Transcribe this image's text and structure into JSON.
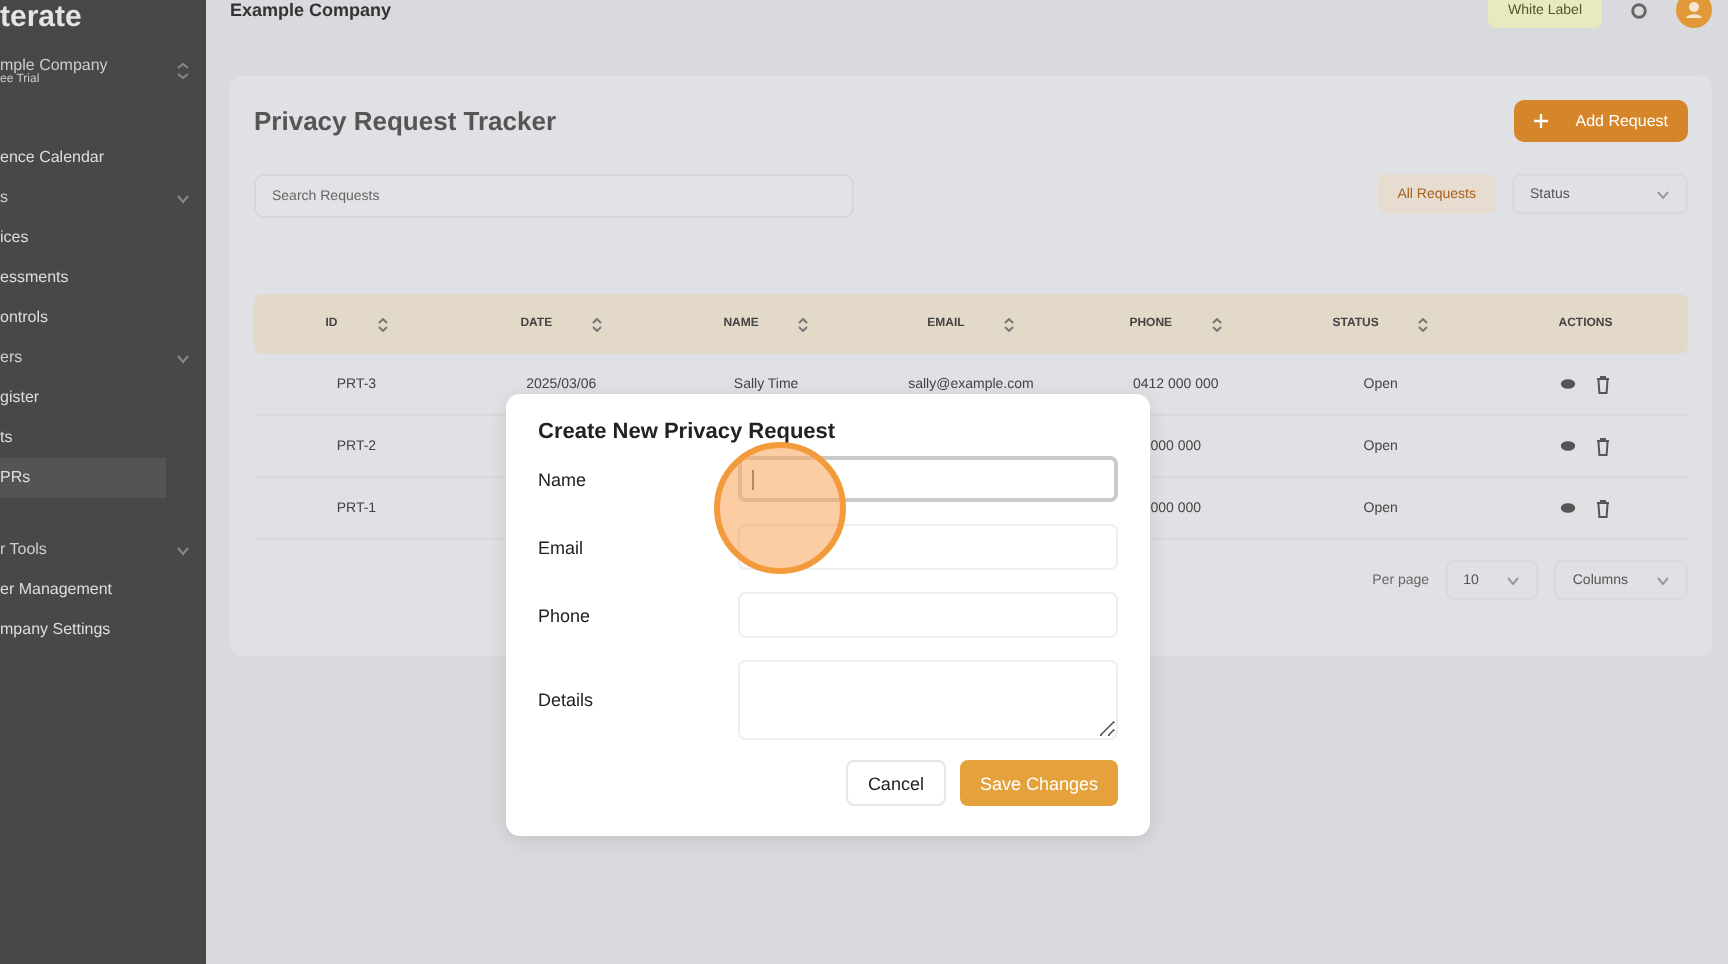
{
  "sidebar": {
    "logo": "terate",
    "company": "mple Company",
    "plan": "ee Trial",
    "items": [
      {
        "kind": "link",
        "label": "ence Calendar",
        "selected": false
      },
      {
        "kind": "group",
        "label": "s",
        "selected": false
      },
      {
        "kind": "link",
        "label": "ices",
        "selected": false
      },
      {
        "kind": "link",
        "label": "essments",
        "selected": false
      },
      {
        "kind": "link",
        "label": "ontrols",
        "selected": false
      },
      {
        "kind": "group",
        "label": "ers",
        "selected": false
      },
      {
        "kind": "link",
        "label": "gister",
        "selected": false
      },
      {
        "kind": "link",
        "label": "ts",
        "selected": false
      },
      {
        "kind": "link",
        "label": "PRs",
        "selected": true
      },
      {
        "kind": "group",
        "label": "r Tools",
        "selected": false
      },
      {
        "kind": "link",
        "label": "er Management",
        "selected": false
      },
      {
        "kind": "link",
        "label": "mpany Settings",
        "selected": false
      }
    ]
  },
  "header": {
    "company": "Example Company",
    "badge": "White Label"
  },
  "page": {
    "title": "Privacy Request Tracker",
    "add_button": "Add Request",
    "search": {
      "placeholder": "Search Requests"
    },
    "filter": "All Requests",
    "status_select": "Status"
  },
  "table": {
    "columns": [
      "ID",
      "DATE",
      "NAME",
      "EMAIL",
      "PHONE",
      "STATUS",
      "ACTIONS"
    ],
    "rows": [
      {
        "id": "PRT-3",
        "date": "2025/03/06",
        "name": "Sally Time",
        "email": "sally@example.com",
        "phone": "0412 000 000",
        "status": "Open"
      },
      {
        "id": "PRT-2",
        "phone": "000 000",
        "status": "Open"
      },
      {
        "id": "PRT-1",
        "phone": "000 000",
        "status": "Open"
      }
    ]
  },
  "pagination": {
    "per_page_label": "Per page",
    "per_page": "10",
    "columns": "Columns"
  },
  "dialog": {
    "title": "Create New Privacy Request",
    "fields": [
      {
        "label": "Name",
        "kind": "input",
        "focused": true
      },
      {
        "label": "Email",
        "kind": "input",
        "focused": false
      },
      {
        "label": "Phone",
        "kind": "input",
        "focused": false
      },
      {
        "label": "Details",
        "kind": "textarea",
        "focused": false
      }
    ],
    "cancel": "Cancel",
    "save": "Save Changes"
  }
}
